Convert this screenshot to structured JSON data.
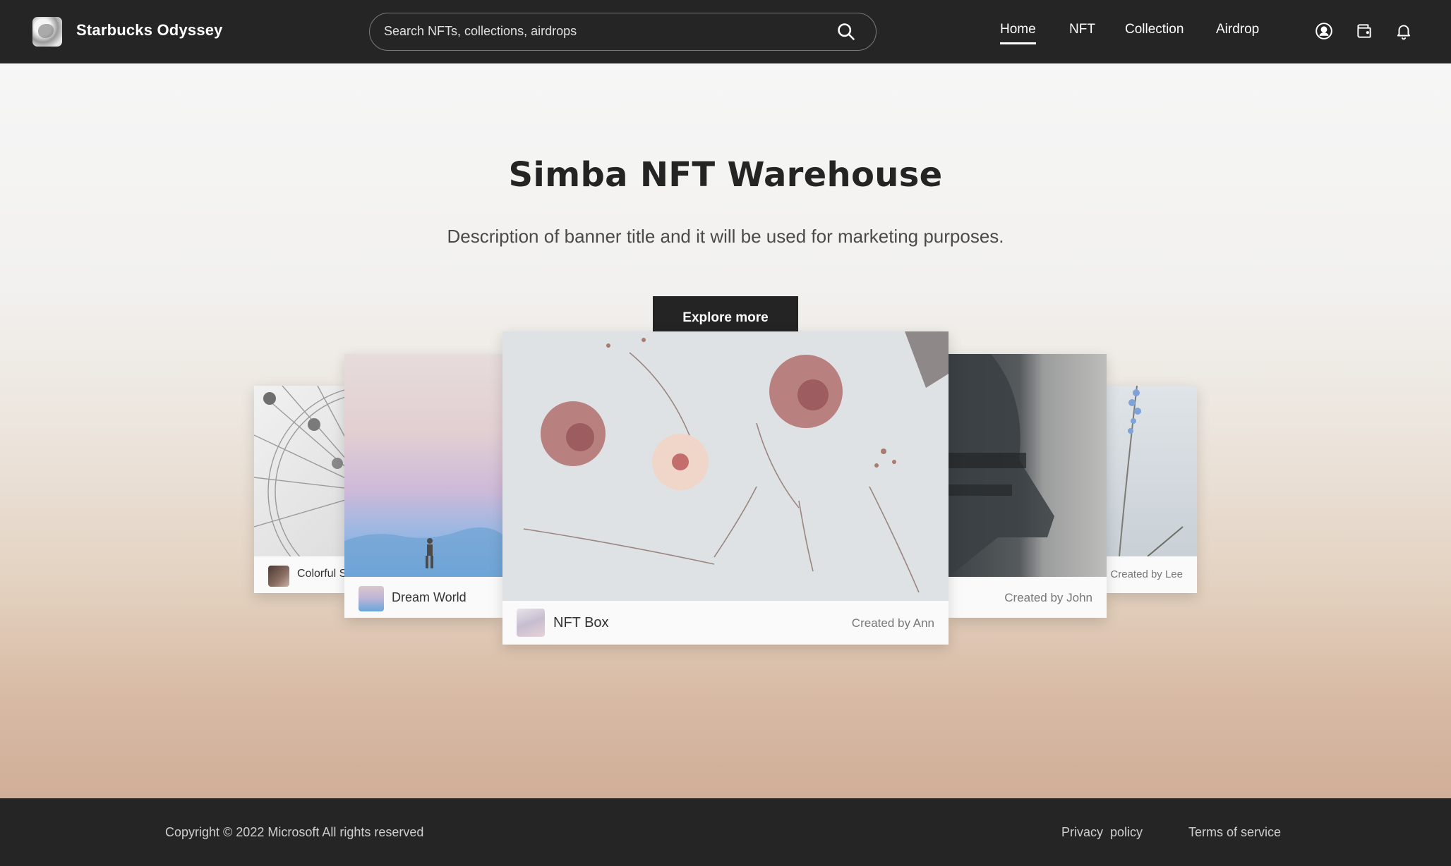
{
  "header": {
    "brand": "Starbucks Odyssey",
    "search": {
      "placeholder": "Search NFTs, collections, airdrops",
      "value": ""
    },
    "nav": [
      {
        "label": "Home",
        "active": true
      },
      {
        "label": "NFT",
        "active": false
      },
      {
        "label": "Collection",
        "active": false
      },
      {
        "label": "Airdrop",
        "active": false
      }
    ],
    "icons": [
      "user-circle-icon",
      "wallet-icon",
      "bell-icon"
    ]
  },
  "hero": {
    "title": "Simba NFT Warehouse",
    "description": "Description of banner title and it will be used for marketing purposes.",
    "cta_label": "Explore more"
  },
  "cards": [
    {
      "name": "Colorful S",
      "creator": ""
    },
    {
      "name": "Dream World",
      "creator": ""
    },
    {
      "name": "NFT Box",
      "creator": "Created by Ann"
    },
    {
      "name": "",
      "creator": "Created by John"
    },
    {
      "name": "",
      "creator": "Created by Lee"
    }
  ],
  "footer": {
    "copyright": "Copyright © 2022 Microsoft All rights reserved",
    "privacy": "Privacy  policy",
    "terms": "Terms of service"
  },
  "colors": {
    "header_bg": "#252525",
    "button_bg": "#242424",
    "text_dark": "#242424",
    "hero_top": "#f6f6f6",
    "hero_bottom": "#d1ae98"
  }
}
